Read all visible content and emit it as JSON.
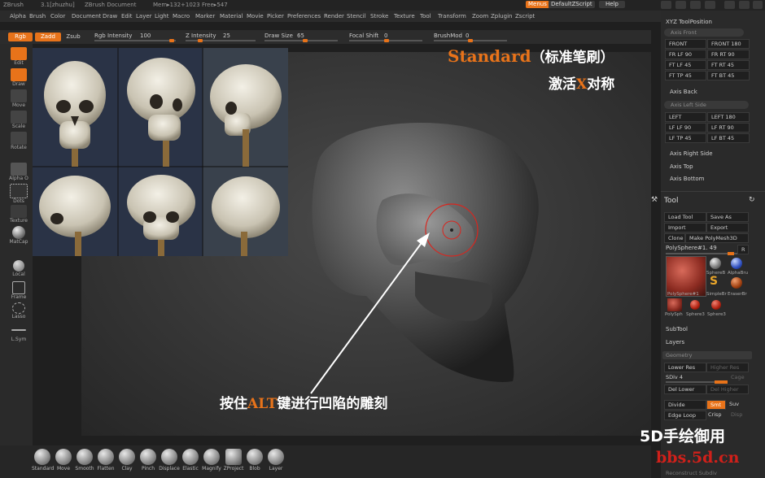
{
  "titlebar": {
    "app": "ZBrush",
    "version": "3.1[zhuzhu]",
    "document": "ZBrush Document",
    "mem": "Mem▸132+1023 Free▸547",
    "menus_button": "Menus",
    "script_button": "DefaultZScript",
    "help_button": "Help"
  },
  "menubar": [
    "Alpha",
    "Brush",
    "Color",
    "Document",
    "Draw",
    "Edit",
    "Layer",
    "Light",
    "Macro",
    "Marker",
    "Material",
    "Movie",
    "Picker",
    "Preferences",
    "Render",
    "Stencil",
    "Stroke",
    "Texture",
    "Tool",
    "Transform",
    "Zoom",
    "Zplugin",
    "Zscript"
  ],
  "drawbar": {
    "rgb": "Rgb",
    "zadd": "Zadd",
    "zsub": "Zsub",
    "rgb_intensity_label": "Rgb Intensity",
    "rgb_intensity": "100",
    "z_intensity_label": "Z Intensity",
    "z_intensity": "25",
    "draw_size_label": "Draw Size",
    "draw_size": "65",
    "focal_shift_label": "Focal Shift",
    "focal_shift": "0",
    "brushmod_label": "BrushMod",
    "brushmod": "0"
  },
  "left_tools": {
    "edit": "Edit",
    "draw": "Draw",
    "move": "Move",
    "scale": "Scale",
    "rotate": "Rotate",
    "alpha": "Alpha  O",
    "dots": "Dots",
    "texture": "Texture",
    "matcap": "MatCap",
    "local": "Local",
    "frame": "Frame",
    "lasso": "Lasso",
    "lsym": "L.Sym"
  },
  "overlay": {
    "title_latin": "Standard",
    "title_cn": "（标准笔刷）",
    "subtitle_a": "激活",
    "subtitle_x": "X",
    "subtitle_b": "对称",
    "note_a": "按住",
    "note_alt": "ALT",
    "note_b": "键进行凹陷的雕刻",
    "watermark_1": "5D手绘御用",
    "watermark_2": "bbs.5d.cn"
  },
  "right_panel": {
    "xyz_title": "XYZ ToolPosition",
    "axis_front": "Axis Front",
    "front": "FRONT",
    "front180": "FRONT 180",
    "fr_lf_90": "FR LF 90",
    "fr_rt_90": "FR RT 90",
    "ft_lf_45": "FT LF 45",
    "ft_rt_45": "FT RT 45",
    "ft_tp_45": "FT TP 45",
    "ft_bt_45": "FT BT 45",
    "axis_back": "Axis Back",
    "axis_left_side": "Axis Left Side",
    "left": "LEFT",
    "left180": "LEFT 180",
    "lf_lf_90": "LF LF 90",
    "lf_rt_90": "LF RT 90",
    "lf_tp_45": "LF TP 45",
    "lf_bt_45": "LF BT 45",
    "axis_right_side": "Axis Right Side",
    "axis_top": "Axis Top",
    "axis_bottom": "Axis Bottom",
    "tool_title": "Tool",
    "load_tool": "Load Tool",
    "save_as": "Save As",
    "import": "Import",
    "export": "Export",
    "clone": "Clone",
    "make_polymesh": "Make PolyMesh3D",
    "polysphere": "PolySphere#1. 49",
    "r": "R",
    "thumb_polysphere": "PolySphere#1",
    "thumb_sphereb": "SphereB",
    "thumb_alphabru": "AlphaBru",
    "thumb_simplebr": "SimpleBr",
    "thumb_eraserbr": "EraserBr",
    "thumb_polysph": "PolySph",
    "thumb_sphere3a": "Sphere3",
    "thumb_sphere3b": "Sphere3",
    "subtool": "SubTool",
    "layers": "Layers",
    "geometry": "Geometry",
    "lower_res": "Lower Res",
    "higher_res": "Higher Res",
    "sdiv": "SDiv 4",
    "cage": "Cage",
    "del_lower": "Del Lower",
    "del_higher": "Del Higher",
    "divide": "Divide",
    "smt": "Smt",
    "suv": "Suv",
    "edge_loop": "Edge Loop",
    "crisp": "Crisp",
    "disp": "Disp",
    "reconstruct": "Reconstruct Subdiv"
  },
  "brushes": [
    "Standard",
    "Move",
    "Smooth",
    "Flatten",
    "Clay",
    "Pinch",
    "Displace",
    "Elastic",
    "Magnify",
    "ZProject",
    "Blob",
    "Layer"
  ],
  "colors": {
    "accent": "#e8731a",
    "overlay_orange": "#e8731a",
    "watermark_red": "#d0201a"
  }
}
